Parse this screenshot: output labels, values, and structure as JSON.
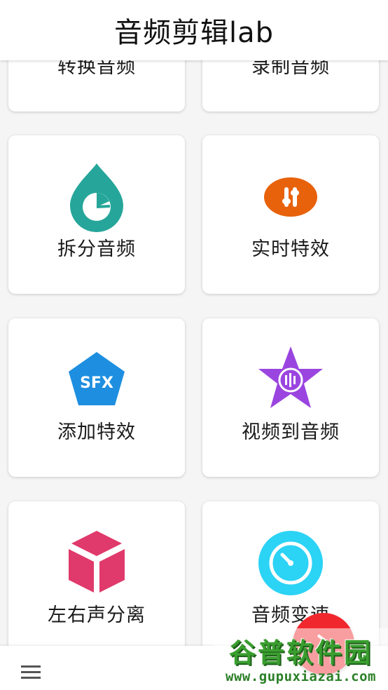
{
  "app": {
    "title": "音频剪辑lab"
  },
  "cards": [
    {
      "label": "转换音频",
      "icon": "convert-audio-icon"
    },
    {
      "label": "录制音频",
      "icon": "record-audio-icon"
    },
    {
      "label": "拆分音频",
      "icon": "split-audio-icon",
      "color": "#26a69a"
    },
    {
      "label": "实时特效",
      "icon": "realtime-effects-icon",
      "color": "#e8620c"
    },
    {
      "label": "添加特效",
      "icon": "sfx-icon",
      "icon_text": "SFX",
      "color": "#1e8fe0"
    },
    {
      "label": "视频到音频",
      "icon": "video-to-audio-icon",
      "color": "#9b45e0"
    },
    {
      "label": "左右声分离",
      "icon": "channel-split-icon",
      "color": "#e0396b"
    },
    {
      "label": "音频变速",
      "icon": "speed-change-icon",
      "color": "#2bd3f5"
    }
  ],
  "watermark": {
    "title": "谷普软件园",
    "url": "www.gupuxiazai.com"
  },
  "colors": {
    "fab": "#f0282e",
    "background": "#f5f5f5"
  }
}
